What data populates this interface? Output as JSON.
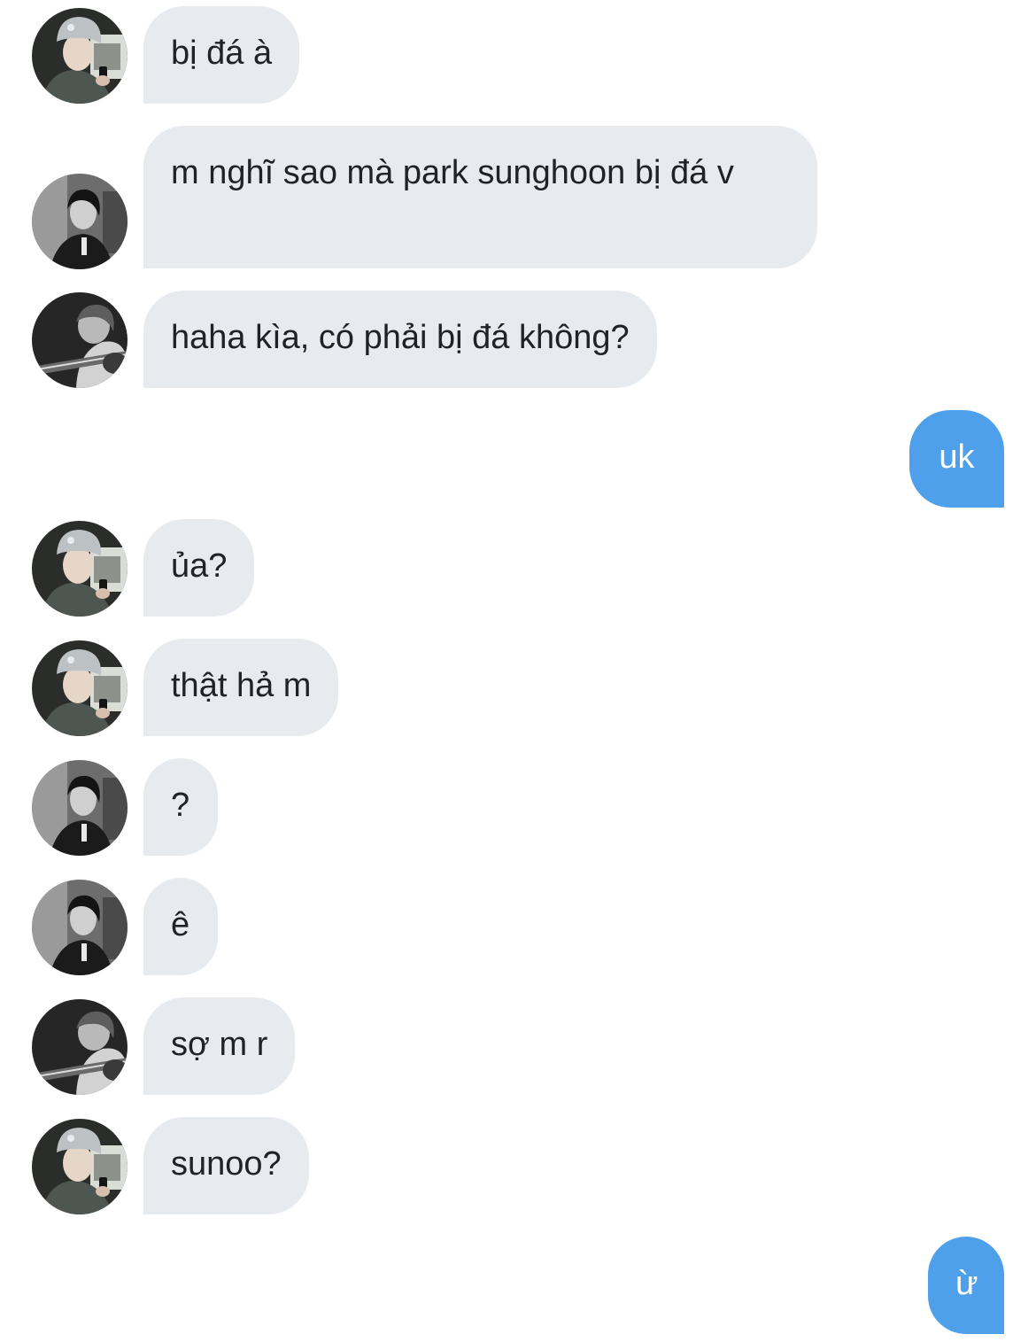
{
  "colors": {
    "incoming_bubble": "#e7ebef",
    "outgoing_bubble": "#4ea0ea",
    "incoming_text": "#1f2328",
    "outgoing_text": "#ffffff"
  },
  "messages": [
    {
      "direction": "incoming",
      "avatar": "avatar-beanie-icon",
      "text": "bị đá à"
    },
    {
      "direction": "incoming",
      "avatar": "avatar-dark-hair-icon",
      "text": "m nghĩ sao mà park sunghoon bị đá v"
    },
    {
      "direction": "incoming",
      "avatar": "avatar-guitar-icon",
      "text": "haha kìa, có phải bị đá không?"
    },
    {
      "direction": "outgoing",
      "text": "uk"
    },
    {
      "direction": "incoming",
      "avatar": "avatar-beanie-icon",
      "text": "ủa?"
    },
    {
      "direction": "incoming",
      "avatar": "avatar-beanie-icon",
      "text": "thật hả m"
    },
    {
      "direction": "incoming",
      "avatar": "avatar-dark-hair-icon",
      "text": "?"
    },
    {
      "direction": "incoming",
      "avatar": "avatar-dark-hair-icon",
      "text": "ê"
    },
    {
      "direction": "incoming",
      "avatar": "avatar-guitar-icon",
      "text": "sợ m r"
    },
    {
      "direction": "incoming",
      "avatar": "avatar-beanie-icon",
      "text": "sunoo?"
    },
    {
      "direction": "outgoing",
      "text": "ừ"
    }
  ]
}
